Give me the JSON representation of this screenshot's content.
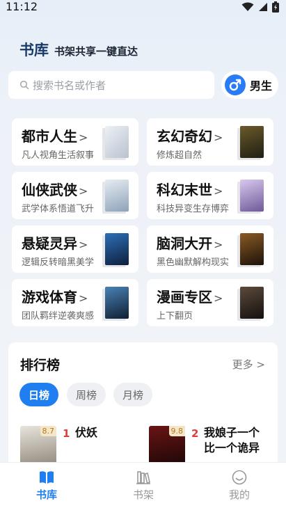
{
  "status_bar": {
    "time": "11:12"
  },
  "header": {
    "title": "书库",
    "subtitle": "书架共享一键直达"
  },
  "search": {
    "placeholder": "搜索书名或作者"
  },
  "gender": {
    "label": "男生",
    "accent": "#2a7cf6"
  },
  "categories": [
    {
      "name": "都市人生",
      "desc": "凡人视角生活叙事",
      "cover_color": "#dfe3ea"
    },
    {
      "name": "玄幻奇幻",
      "desc": "修炼超自然",
      "cover_color": "#3b3c2a"
    },
    {
      "name": "仙侠武侠",
      "desc": "武学体系悟道飞升",
      "cover_color": "#cfd8e2"
    },
    {
      "name": "科幻末世",
      "desc": "科技异变生存博弈",
      "cover_color": "#a98ec6"
    },
    {
      "name": "悬疑灵异",
      "desc": "逻辑反转暗黑美学",
      "cover_color": "#1c3a66"
    },
    {
      "name": "脑洞大开",
      "desc": "黑色幽默解构现实",
      "cover_color": "#3a2414"
    },
    {
      "name": "游戏体育",
      "desc": "团队羁绊逆袭爽感",
      "cover_color": "#1d3550"
    },
    {
      "name": "漫画专区",
      "desc": "上下翻页",
      "cover_color": "#2a2320"
    }
  ],
  "ranking": {
    "title": "排行榜",
    "more": "更多",
    "tabs": [
      {
        "label": "日榜",
        "active": true
      },
      {
        "label": "周榜",
        "active": false
      },
      {
        "label": "月榜",
        "active": false
      }
    ],
    "books": [
      {
        "rank": "1",
        "title": "伏妖",
        "rating": "8.7"
      },
      {
        "rank": "2",
        "title": "我娘子一个比一个诡异",
        "title_line1": "我娘子一个",
        "title_line2": "比一个诡异",
        "rating": "9.8"
      }
    ]
  },
  "nav": [
    {
      "label": "书库",
      "active": true,
      "icon": "book-open-icon"
    },
    {
      "label": "书架",
      "active": false,
      "icon": "bookshelf-icon"
    },
    {
      "label": "我的",
      "active": false,
      "icon": "smile-face-icon"
    }
  ],
  "colors": {
    "accent": "#1f7ef0",
    "rank_red": "#e33b3b",
    "title_blue": "#1a3a6b"
  }
}
